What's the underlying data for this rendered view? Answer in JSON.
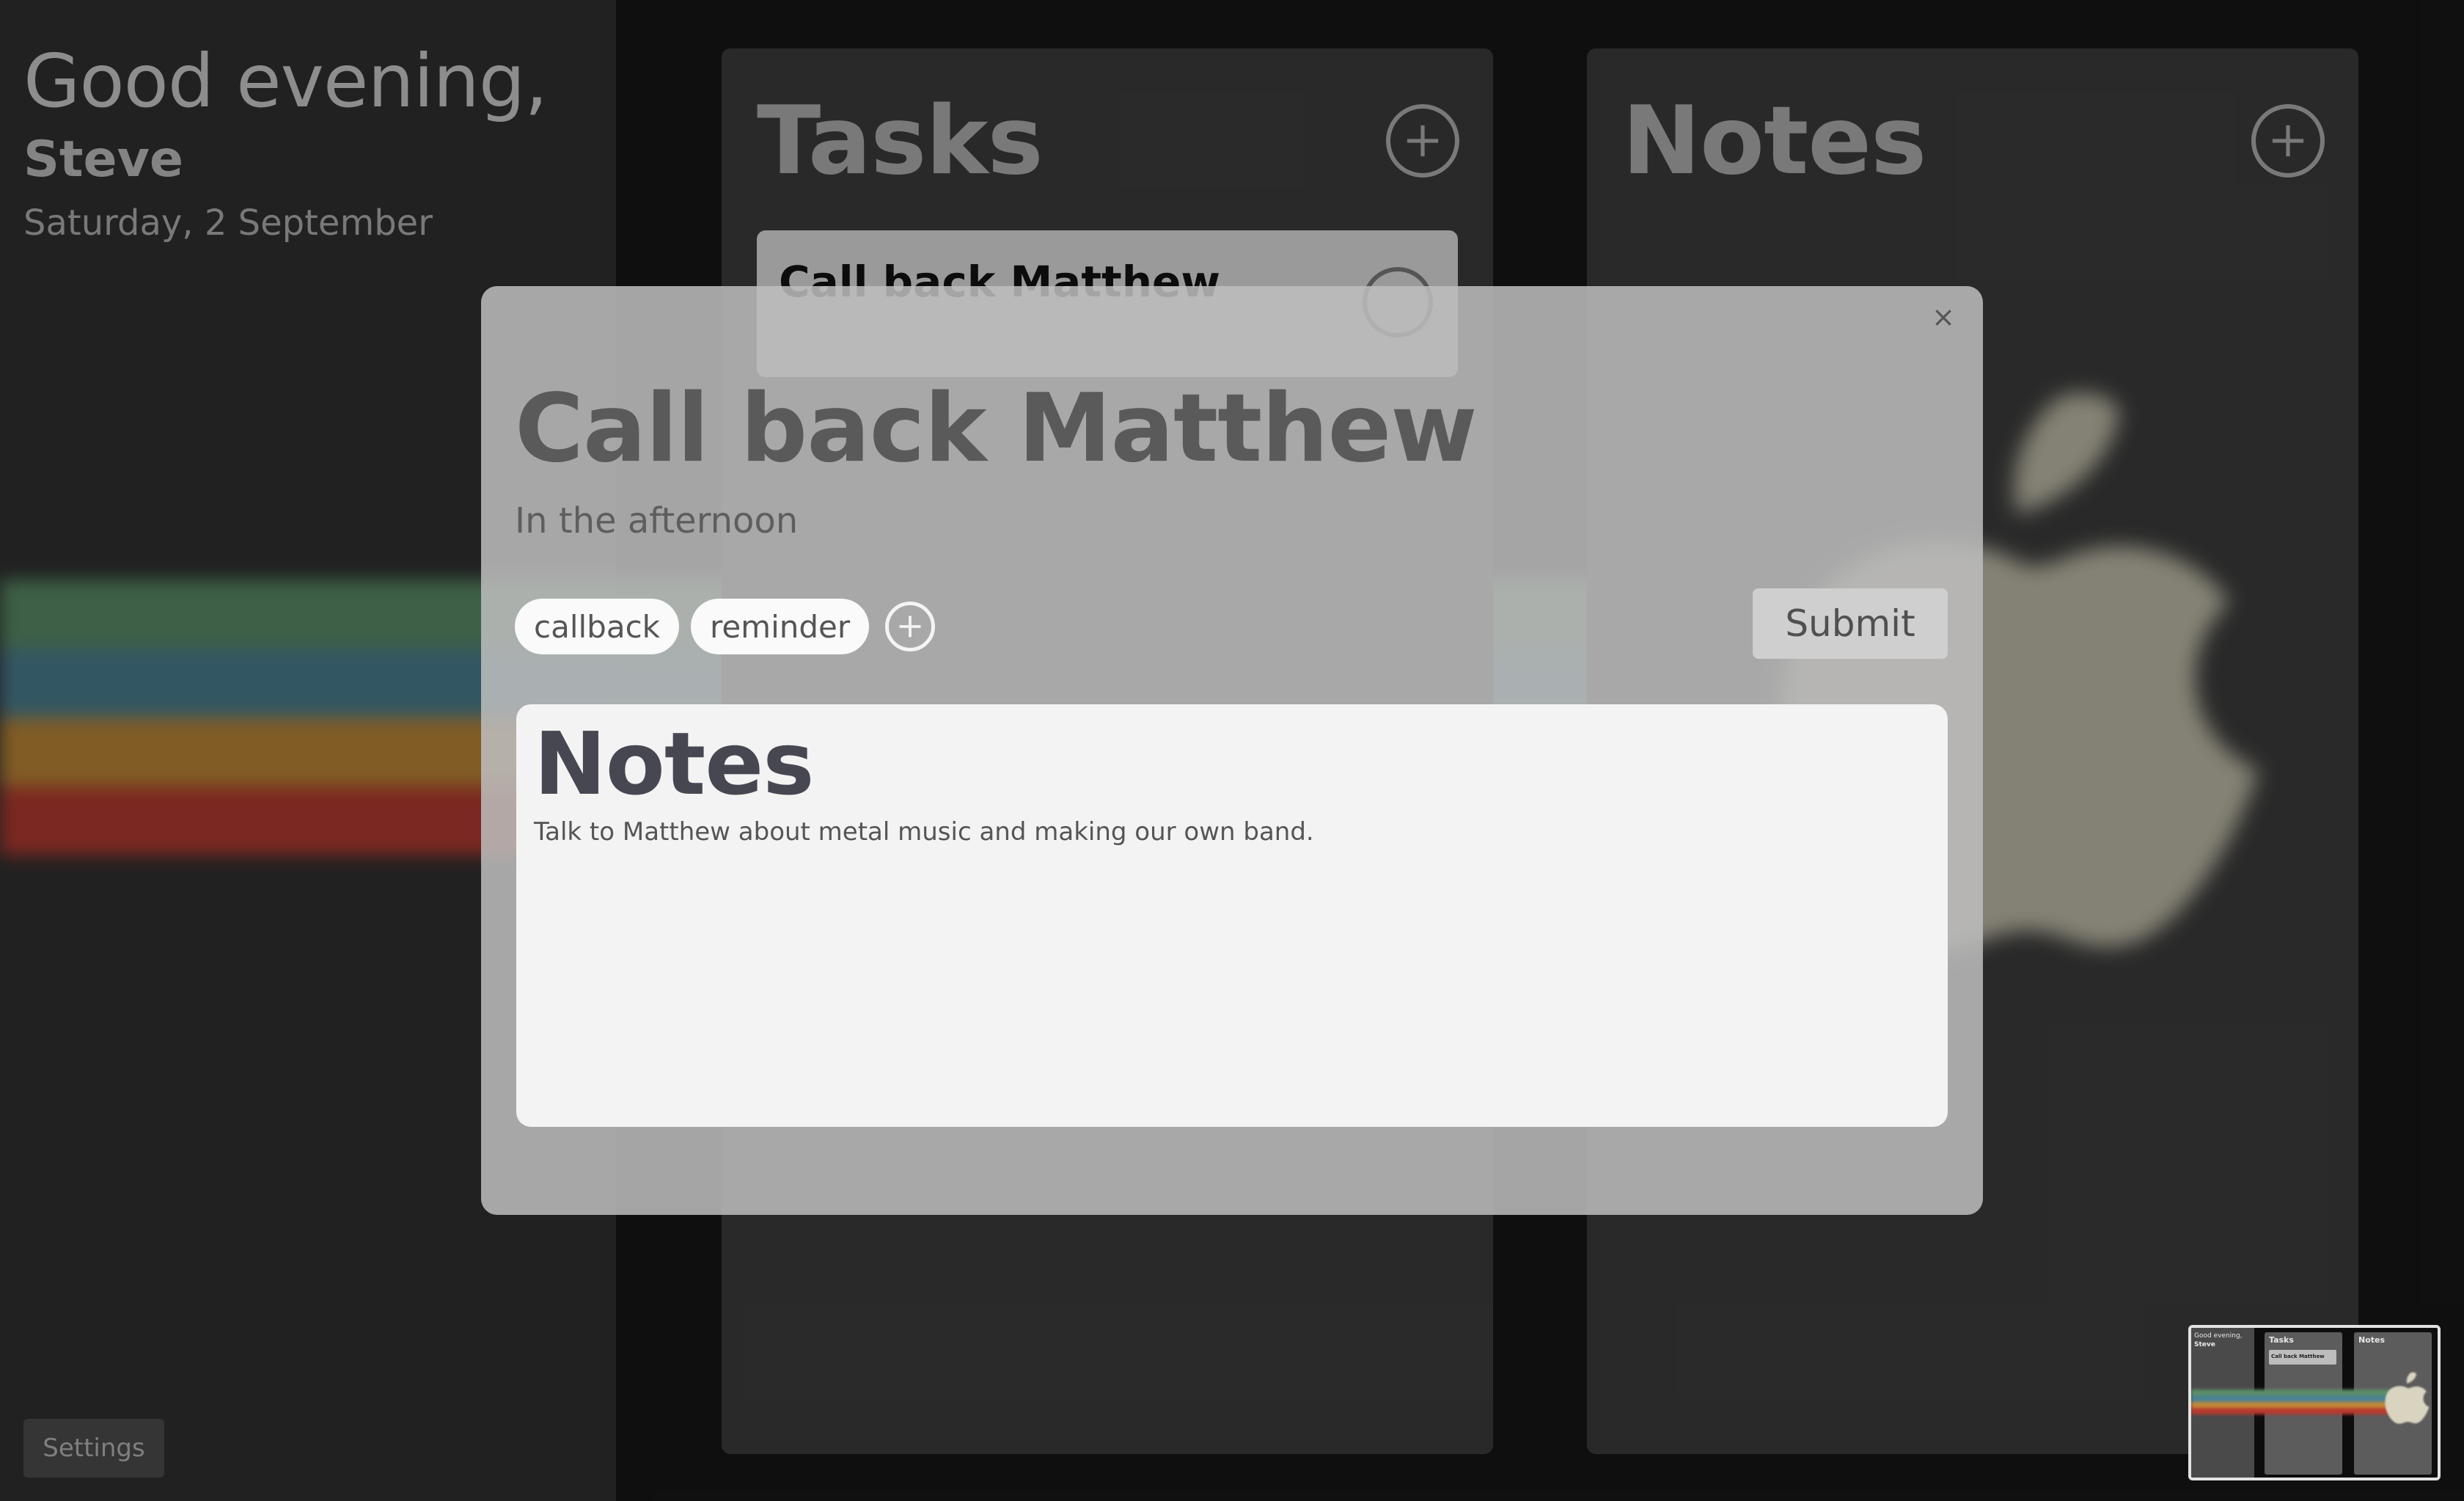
{
  "sidebar": {
    "greeting": "Good evening,",
    "user_name": "Steve",
    "date": "Saturday, 2 September",
    "settings_label": "Settings"
  },
  "tasks_column": {
    "title": "Tasks",
    "add_icon": "plus-circle-icon",
    "cards": [
      {
        "title": "Call back Matthew"
      }
    ]
  },
  "notes_column": {
    "title": "Notes",
    "add_icon": "plus-circle-icon"
  },
  "modal": {
    "close_label": "×",
    "title": "Call back Matthew",
    "subtitle": "In the afternoon",
    "tags": [
      "callback",
      "reminder"
    ],
    "submit_label": "Submit",
    "notes_heading": "Notes",
    "notes_body": "Talk to Matthew about metal music and making our own band."
  },
  "minimap": {
    "greeting": "Good evening,",
    "user_name": "Steve",
    "tasks_title": "Tasks",
    "notes_title": "Notes",
    "card_title": "Call back Matthew"
  },
  "colors": {
    "background": "#161616",
    "sidebar": "#2e2e2e",
    "column": "#3a3a3a",
    "modal": "#bebebe",
    "notes_panel": "#f3f3f3",
    "rainbow": [
      "#5b8f68",
      "#4a8194",
      "#c28a36",
      "#b83a2e",
      "#3c3c3c"
    ]
  }
}
